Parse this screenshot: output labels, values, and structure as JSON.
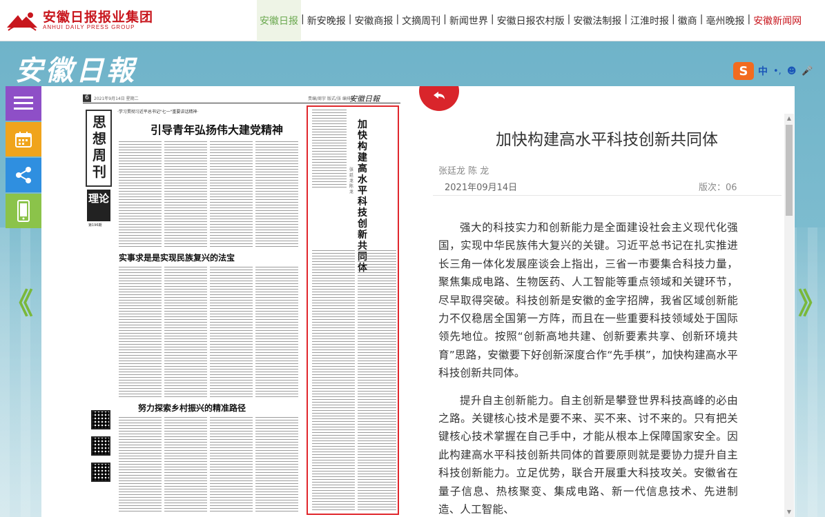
{
  "header": {
    "brand_cn": "安徽日报报业集团",
    "brand_en": "ANHUI DAILY PRESS GROUP",
    "nav": [
      {
        "label": "安徽日报",
        "active": true
      },
      {
        "label": "新安晚报"
      },
      {
        "label": "安徽商报"
      },
      {
        "label": "文摘周刊"
      },
      {
        "label": "新闻世界"
      },
      {
        "label": "安徽日报农村版"
      },
      {
        "label": "安徽法制报"
      },
      {
        "label": "江淮时报"
      },
      {
        "label": "徽商"
      },
      {
        "label": "亳州晚报"
      },
      {
        "label": "安徽新闻网",
        "red": true
      }
    ]
  },
  "masthead": "安徽日報",
  "ime": {
    "s": "S",
    "label": "中",
    "punct": "•,",
    "emoji": "☻",
    "mic": "🎤"
  },
  "nav_arrows": {
    "left": "《",
    "right": "》"
  },
  "newspaper": {
    "page_no": "6",
    "date_line": "2021年9月14日 星期二",
    "right_head": "责编/周宇 版式/张 编排/X",
    "logo": "安徽日報",
    "column_title": "思想周刊",
    "column_sub": "理论",
    "column_sub_small": "第196期",
    "kicker": "·学习贯彻习近平总书记\"七一\"重要讲话精神·",
    "headline1": "引导青年弘扬伟大建党精神",
    "headline2": "实事求是是实现民族复兴的法宝",
    "headline3": "努力探索乡村振兴的精准路径",
    "vertical_headline": "加快构建高水平科技创新共同体",
    "vertical_author": "张廷龙 陈龙"
  },
  "article": {
    "title": "加快构建高水平科技创新共同体",
    "author": "张廷龙 陈 龙",
    "date": "2021年09月14日",
    "edition": "版次：06",
    "paragraphs": [
      "强大的科技实力和创新能力是全面建设社会主义现代化强国，实现中华民族伟大复兴的关键。习近平总书记在扎实推进长三角一体化发展座谈会上指出，三省一市要集合科技力量，聚焦集成电路、生物医药、人工智能等重点领域和关键环节，尽早取得突破。科技创新是安徽的金字招牌，我省区域创新能力不仅稳居全国第一方阵，而且在一些重要科技领域处于国际领先地位。按照“创新高地共建、创新要素共享、创新环境共育”思路，安徽要下好创新深度合作“先手棋”，加快构建高水平科技创新共同体。",
      "提升自主创新能力。自主创新是攀登世界科技高峰的必由之路。关键核心技术是要不来、买不来、讨不来的。只有把关键核心技术掌握在自己手中，才能从根本上保障国家安全。因此构建高水平科技创新共同体的首要原则就是要协力提升自主科技创新能力。立足优势，联合开展重大科技攻关。安徽省在量子信息、热核聚变、集成电路、新一代信息技术、先进制造、人工智能、"
    ]
  }
}
